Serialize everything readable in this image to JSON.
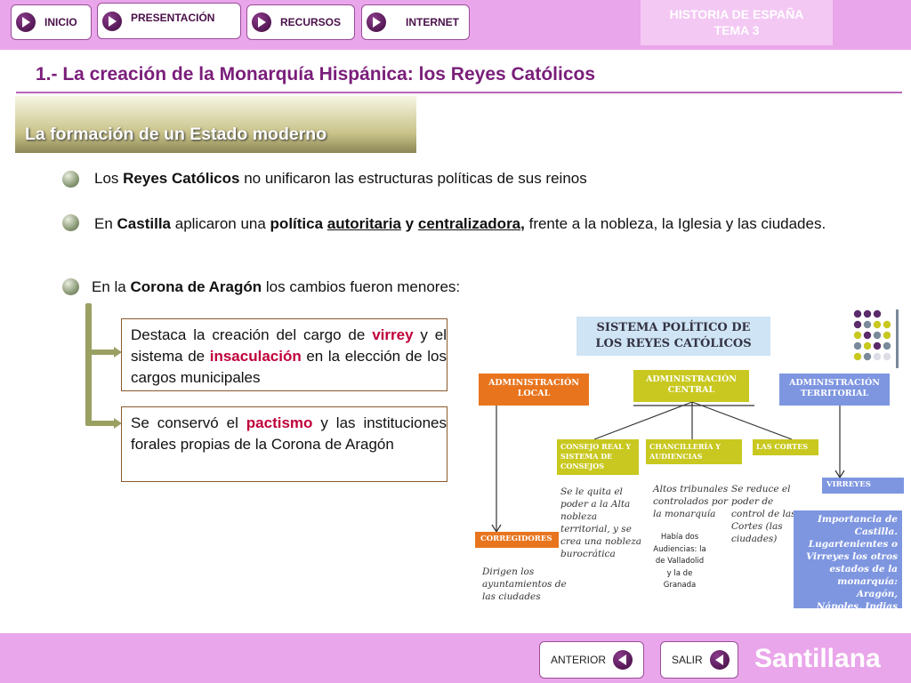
{
  "nav": {
    "items": [
      {
        "label": "INICIO"
      },
      {
        "label": "PRESENTACIÓN"
      },
      {
        "label": "RECURSOS"
      },
      {
        "label": "INTERNET"
      }
    ],
    "topic_line1": "HISTORIA DE ESPAÑA",
    "topic_line2": "TEMA 3"
  },
  "page": {
    "title": "1.- La creación de la Monarquía Hispánica: los Reyes Católicos",
    "subtitle": "La formación de un Estado moderno"
  },
  "bullets": {
    "b1": {
      "t1": "Los ",
      "b1": "Reyes Católicos",
      "t2": " no unificaron las estructuras políticas de sus reinos"
    },
    "b2": {
      "t1": "En ",
      "b1": "Castilla",
      "t2": " aplicaron una ",
      "b2": "política",
      "t3": " ",
      "u1": "autoritaria",
      "t4": " ",
      "b3": "y",
      "t5": " ",
      "u2": "centralizadora",
      "b4": ",",
      "t6": " frente a la nobleza, la Iglesia y las ciudades."
    },
    "b3": {
      "t1": "En la ",
      "b1": "Corona de Aragón",
      "t2": " los cambios fueron menores:"
    }
  },
  "boxes": {
    "box1": {
      "t1": "Destaca la creación del cargo de ",
      "r1": "virrey",
      "t2": " y el sistema de ",
      "r2": "insaculación",
      "t3": " en la elección de los cargos municipales"
    },
    "box2": {
      "t1": "Se conservó el ",
      "r1": "pactismo",
      "t2": " y las instituciones forales propias de la Corona de Aragón"
    }
  },
  "diagram": {
    "title_line1": "SISTEMA POLÍTICO DE",
    "title_line2": "LOS REYES CATÓLICOS",
    "admin_local_1": "ADMINISTRACIÓN",
    "admin_local_2": "LOCAL",
    "admin_central_1": "ADMINISTRACIÓN",
    "admin_central_2": "CENTRAL",
    "admin_territorial_1": "ADMINISTRACIÓN",
    "admin_territorial_2": "TERRITORIAL",
    "consejo_1": "CONSEJO REAL Y",
    "consejo_2": "SISTEMA DE",
    "consejo_3": "CONSEJOS",
    "chanc_1": "CHANCILLERÍA Y",
    "chanc_2": "AUDIENCIAS",
    "cortes": "LAS CORTES",
    "virreyes": "VIRREYES",
    "corregidores": "CORREGIDORES",
    "note_consejo": [
      "Se le quita el",
      "poder a la Alta",
      "nobleza",
      "territorial, y se",
      "crea una nobleza",
      "burocrática"
    ],
    "note_chanc": [
      "Altos tribunales",
      "controlados por",
      "la monarquía"
    ],
    "note_cortes": [
      "Se reduce el",
      "poder de",
      "control de las",
      "Cortes (las",
      "ciudades)"
    ],
    "note_audiencias": [
      "Había dos",
      "Audiencias: la",
      "de Valladolid",
      "y la de",
      "Granada"
    ],
    "note_corregidores": [
      "Dirigen los",
      "ayuntamientos de",
      "las ciudades"
    ],
    "note_virreyes": [
      "Importancia de",
      "Castilla.",
      "Lugartenientes o",
      "Virreyes los otros",
      "estados de la",
      "monarquía: Aragón,",
      "Nápoles, Indias"
    ]
  },
  "colors": {
    "accent": "#eaa6ea",
    "title": "#7a1e7a",
    "highlight": "#c0003a",
    "orange": "#e8751e",
    "yellow_green": "#c8c820",
    "blue": "#7e96e0",
    "light_blue": "#cfe4f4"
  },
  "footer": {
    "prev_label": "ANTERIOR",
    "exit_label": "SALIR",
    "brand": "Santillana"
  }
}
